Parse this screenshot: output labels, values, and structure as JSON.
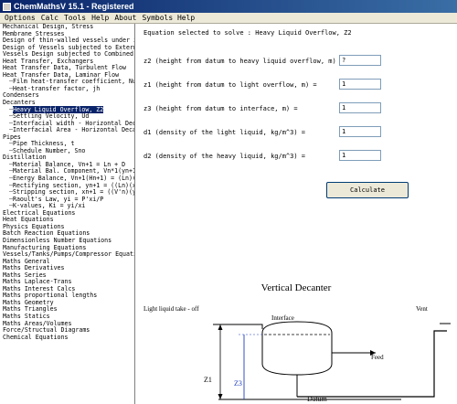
{
  "window": {
    "title": "ChemMathsV 15.1 - Registered"
  },
  "menu": [
    "Options",
    "Calc",
    "Tools",
    "Help",
    "About",
    "Symbols Help"
  ],
  "tree": [
    {
      "label": "Mechanical Design, Stress",
      "level": 0
    },
    {
      "label": "Membrane Stresses",
      "level": 0
    },
    {
      "label": "Design of thin-walled vessels under in",
      "level": 0
    },
    {
      "label": "Design of Vessels subjected to Externa",
      "level": 0
    },
    {
      "label": "Vessels Design subjected to Combined L",
      "level": 0
    },
    {
      "label": "Heat Transfer, Exchangers",
      "level": 0
    },
    {
      "label": "Heat Transfer Data, Turbulent Flow",
      "level": 0
    },
    {
      "label": "Heat Transfer Data, Laminar Flow",
      "level": 0
    },
    {
      "label": "Film heat-transfer coefficient, Nu",
      "level": 1
    },
    {
      "label": "Heat-transfer factor, jh",
      "level": 1
    },
    {
      "label": "Condensers",
      "level": 0
    },
    {
      "label": "Decanters",
      "level": 0
    },
    {
      "label": "Heavy Liquid Overflow, Z2",
      "level": 1,
      "selected": true
    },
    {
      "label": "Settling Velocity, Ud",
      "level": 1
    },
    {
      "label": "Interfacial width - Horizontal Dec",
      "level": 1
    },
    {
      "label": "Interfacial Area - Horizontal Deca",
      "level": 1
    },
    {
      "label": "Pipes",
      "level": 0
    },
    {
      "label": "Pipe Thickness, t",
      "level": 1
    },
    {
      "label": "Schedule Number, Sno",
      "level": 1
    },
    {
      "label": "Distillation",
      "level": 0
    },
    {
      "label": "Material Balance, Vn+1 = Ln + D",
      "level": 1
    },
    {
      "label": "Material Bal. Component, Vn*1(yn+1",
      "level": 1
    },
    {
      "label": "Energy Balance, Vn+1(Hn+1) = (Ln)(",
      "level": 1
    },
    {
      "label": "Rectifying section, yn+1 = ((Ln)(x",
      "level": 1
    },
    {
      "label": "Stripping section, xn+1 = ((V'n)(y",
      "level": 1
    },
    {
      "label": "Raoult's Law, yi = P'xi/P",
      "level": 1
    },
    {
      "label": "K-values, Ki = yi/xi",
      "level": 1
    },
    {
      "label": "Electrical Equations",
      "level": 0
    },
    {
      "label": "Heat Equations",
      "level": 0
    },
    {
      "label": "Physics Equations",
      "level": 0
    },
    {
      "label": "Batch Reaction Equations",
      "level": 0
    },
    {
      "label": "Dimensionless Number Equations",
      "level": 0
    },
    {
      "label": "Manufacturing Equations",
      "level": 0
    },
    {
      "label": "Vessels/Tanks/Pumps/Compressor Equati",
      "level": 0
    },
    {
      "label": "Maths General",
      "level": 0
    },
    {
      "label": "Maths Derivatives",
      "level": 0
    },
    {
      "label": "Maths Series",
      "level": 0
    },
    {
      "label": "Maths Laplace-Trans",
      "level": 0
    },
    {
      "label": "Maths Interest Calcs",
      "level": 0
    },
    {
      "label": "Maths proportional lengths",
      "level": 0
    },
    {
      "label": "Maths Geometry",
      "level": 0
    },
    {
      "label": "Maths Triangles",
      "level": 0
    },
    {
      "label": "Maths Statics",
      "level": 0
    },
    {
      "label": "Maths Areas/Volumes",
      "level": 0
    },
    {
      "label": "Force/Structual Diagrams",
      "level": 0
    },
    {
      "label": "Chemical Equations",
      "level": 0
    }
  ],
  "main": {
    "equation_label": "Equation selected to solve : Heavy Liquid Overflow, Z2",
    "fields": [
      {
        "label": "z2 (height from datum to heavy liquid overflow, m) =",
        "value": "?"
      },
      {
        "label": "z1 (height from datum to light overflow, m) =",
        "value": "1"
      },
      {
        "label": "z3 (height from datum to interface, m) =",
        "value": "1"
      },
      {
        "label": "d1 (density of the light liquid, kg/m^3) =",
        "value": "1"
      },
      {
        "label": "d2 (density of the heavy liquid, kg/m^3) =",
        "value": "1"
      }
    ],
    "calculate_label": "Calculate"
  },
  "diagram": {
    "title": "Vertical Decanter",
    "light_takeoff": "Light liquid take - off",
    "interface": "Interface",
    "vent": "Vent",
    "feed": "Feed",
    "z1": "Z1",
    "z3": "Z3",
    "datum": "Datum"
  }
}
